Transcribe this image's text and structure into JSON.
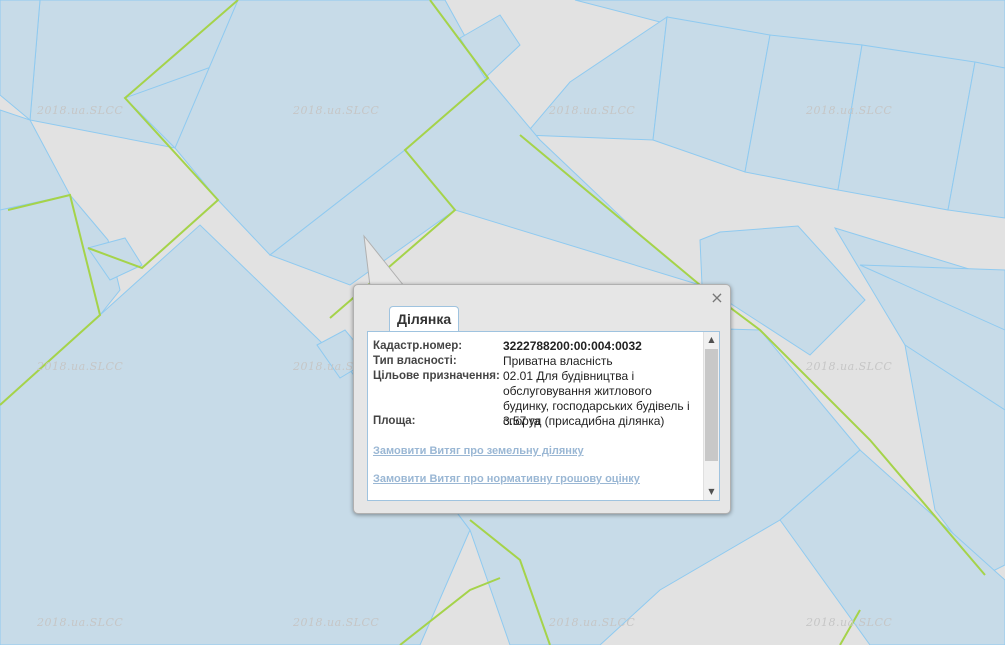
{
  "map": {
    "watermark": "2018.ua.SLCC",
    "colors": {
      "road": "#e2e2e2",
      "parcel_fill": "#c7dbe8",
      "parcel_border": "#8fcaf0",
      "boundary": "#a5d34a"
    }
  },
  "popup": {
    "tab_label": "Ділянка",
    "close_label": "×",
    "fields": {
      "cadastral_label": "Кадастр.номер:",
      "cadastral_value": "3222788200:00:004:0032",
      "ownership_label": "Тип власності:",
      "ownership_value": "Приватна власність",
      "purpose_label": "Цільове призначення:",
      "purpose_value": "02.01 Для будівництва і обслуговування житлового будинку, господарських будівель і споруд (присадибна ділянка)",
      "area_label": "Площа:",
      "area_value": "3.57 га"
    },
    "links": {
      "order_extract": "Замовити Витяг про земельну ділянку",
      "order_valuation": "Замовити Витяг про нормативну грошову оцінку"
    },
    "scrollbar": {
      "up": "▲",
      "down": "▼"
    }
  }
}
